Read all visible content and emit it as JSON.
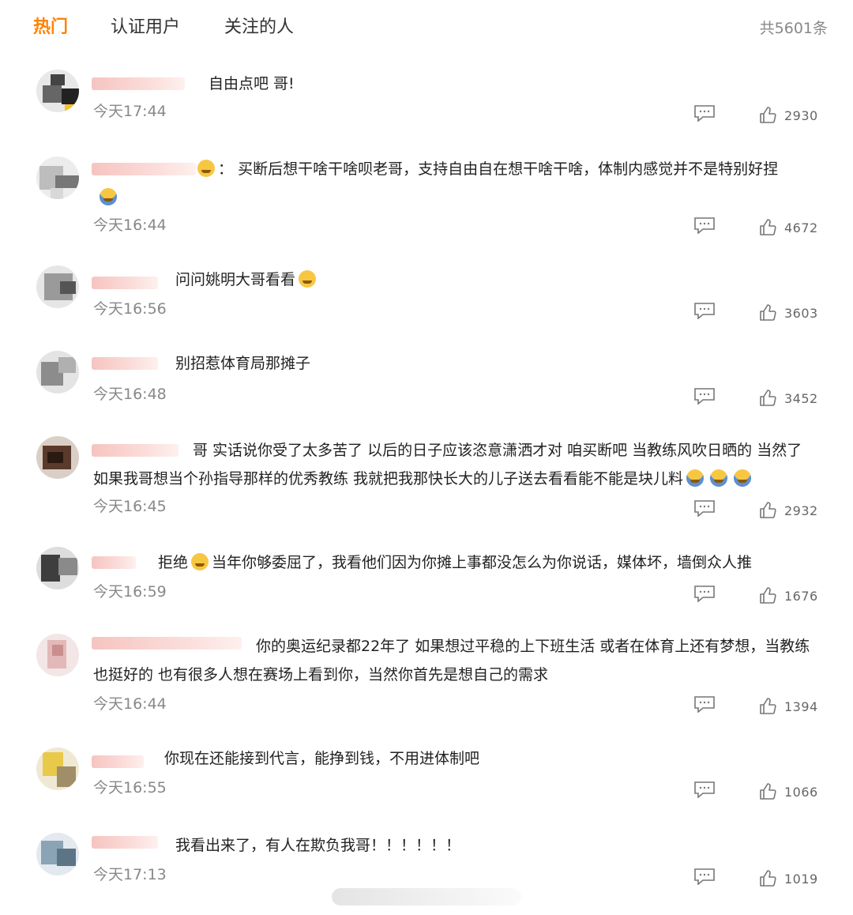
{
  "tabs": {
    "hot": "热门",
    "verified": "认证用户",
    "following": "关注的人"
  },
  "total_count": "共5601条",
  "colors": {
    "active_tab": "#ff8200",
    "username_blur": "#f6c4c0"
  },
  "comments": [
    {
      "prefix": "",
      "text": "自由点吧 哥!",
      "time": "今天17:44",
      "likes": "2930",
      "emojis": []
    },
    {
      "prefix": "：",
      "text": "买断后想干啥干啥呗老哥，支持自由自在想干啥干啥，体制内感觉并不是特别好捏",
      "time": "今天16:44",
      "likes": "4672",
      "emojis": [
        "emoji-icon",
        "emoji-icon"
      ]
    },
    {
      "prefix": "",
      "text": "问问姚明大哥看看",
      "time": "今天16:56",
      "likes": "3603",
      "emojis": [
        "laugh-cry-emoji-icon"
      ]
    },
    {
      "prefix": "",
      "text": "别招惹体育局那摊子",
      "time": "今天16:48",
      "likes": "3452",
      "emojis": []
    },
    {
      "prefix": "",
      "text": "哥 实话说你受了太多苦了 以后的日子应该恣意潇洒才对 咱买断吧 当教练风吹日晒的 当然了 如果我哥想当个孙指导那样的优秀教练 我就把我那快长大的儿子送去看看能不能是块儿料",
      "time": "今天16:45",
      "likes": "2932",
      "emojis": [
        "emoji-icon",
        "emoji-icon",
        "emoji-icon"
      ]
    },
    {
      "prefix": "拒绝",
      "text": "当年你够委屈了，我看他们因为你摊上事都没怎么为你说话，媒体坏，墙倒众人推",
      "time": "今天16:59",
      "likes": "1676",
      "emojis": [
        "emoji-icon"
      ]
    },
    {
      "prefix": "",
      "text": "你的奥运纪录都22年了 如果想过平稳的上下班生活 或者在体育上还有梦想，当教练也挺好的 也有很多人想在赛场上看到你，当然你首先是想自己的需求",
      "time": "今天16:44",
      "likes": "1394",
      "emojis": []
    },
    {
      "prefix": "",
      "text": "你现在还能接到代言，能挣到钱，不用进体制吧",
      "time": "今天16:55",
      "likes": "1066",
      "emojis": []
    },
    {
      "prefix": "",
      "text": "我看出来了，有人在欺负我哥！！！！！！",
      "time": "今天17:13",
      "likes": "1019",
      "emojis": []
    }
  ]
}
